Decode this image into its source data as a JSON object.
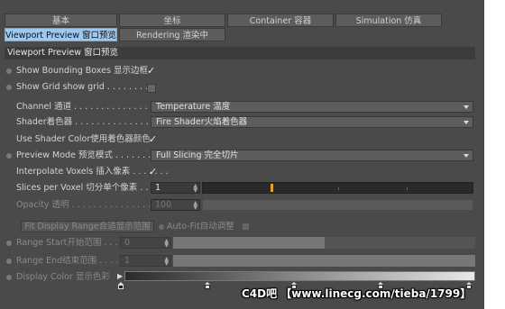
{
  "tabs_row1": [
    "基本",
    "坐标",
    "Container 容器",
    "Simulation 仿真"
  ],
  "tabs_row2": [
    "Viewport Preview 窗口预览",
    "Rendering 渲染中"
  ],
  "section_title": "Viewport Preview 窗口预览",
  "show_bounding_boxes": {
    "label": "Show Bounding Boxes 显示边框",
    "checked": true
  },
  "show_grid": {
    "label": "Show Grid show grid . . . . . . . . .",
    "checked": false
  },
  "channel": {
    "label": "Channel 通道 . . . . . . . . . . . . . . . . . . .",
    "value": "Temperature 温度"
  },
  "shader": {
    "label": "Shader着色器 . . . . . . . . . . . . . . . . . .",
    "value": "Fire Shader火焰着色器"
  },
  "use_shader_color": {
    "label": "Use Shader Color使用着色器颜色",
    "checked": true
  },
  "preview_mode": {
    "label": "Preview Mode 预览模式 . . . . . . . . .",
    "value": "Full Slicing 完全切片"
  },
  "interpolate_voxels": {
    "label": "Interpolate Voxels 插入像素 . . . . . . .",
    "checked": true
  },
  "slices_per_voxel": {
    "label": "Slices per Voxel 切分单个像素 . . .",
    "value": "1",
    "slider_level": 0.25
  },
  "opacity": {
    "label": "Opacity 透明 . . . . . . . . . . . . . . . . .",
    "value": "100"
  },
  "fit_display_range": {
    "label": "Fit Display Range合适显示范围"
  },
  "auto_fit": {
    "label": "Auto-Fit自动调整"
  },
  "range_start": {
    "label": "Range Start开始范围 . . . . . .",
    "value": "0",
    "fill": 0.5
  },
  "range_end": {
    "label": "Range End结束范围 . . . . . . .",
    "value": "1",
    "fill": 1.0
  },
  "display_color": {
    "label": "Display Color 显示色彩"
  },
  "watermark": "C4D吧 【www.linecg.com/tieba/1799】"
}
